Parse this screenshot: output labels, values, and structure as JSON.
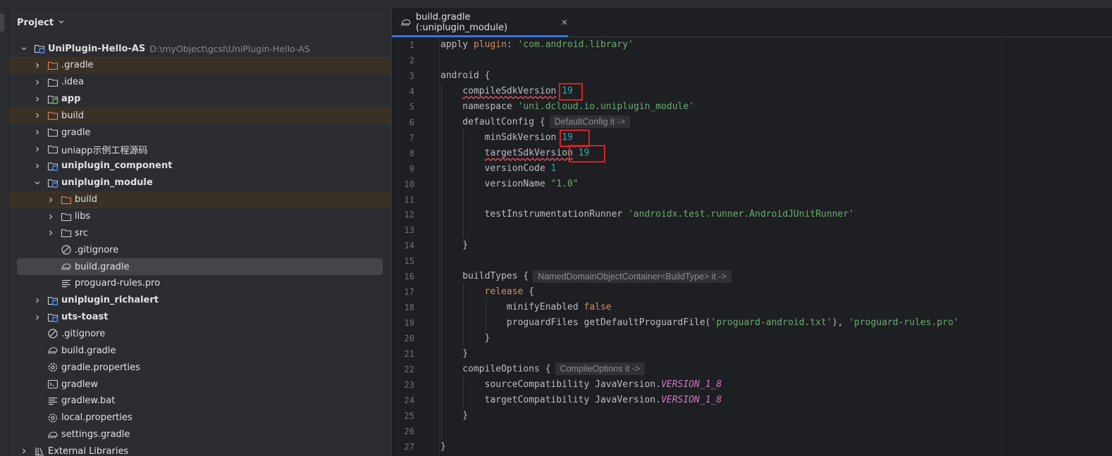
{
  "panel": {
    "title": "Project"
  },
  "tree": [
    {
      "label": "UniPlugin-Hello-AS",
      "path": "D:\\myObject\\gcsl\\UniPlugin-Hello-AS",
      "icon": "module-folder-icon",
      "arrow": "down",
      "depth": 0,
      "bold": true
    },
    {
      "label": ".gradle",
      "icon": "excluded-folder-icon",
      "arrow": "right",
      "depth": 1,
      "excluded": true
    },
    {
      "label": ".idea",
      "icon": "folder-icon",
      "arrow": "right",
      "depth": 1
    },
    {
      "label": "app",
      "icon": "app-module-icon",
      "arrow": "right",
      "depth": 1,
      "bold": true
    },
    {
      "label": "build",
      "icon": "excluded-folder-icon",
      "arrow": "right",
      "depth": 1,
      "excluded": true
    },
    {
      "label": "gradle",
      "icon": "folder-icon",
      "arrow": "right",
      "depth": 1
    },
    {
      "label": "uniapp示例工程源码",
      "icon": "folder-icon",
      "arrow": "right",
      "depth": 1
    },
    {
      "label": "uniplugin_component",
      "icon": "module-folder-icon",
      "arrow": "right",
      "depth": 1,
      "bold": true
    },
    {
      "label": "uniplugin_module",
      "icon": "module-folder-icon",
      "arrow": "down",
      "depth": 1,
      "bold": true
    },
    {
      "label": "build",
      "icon": "excluded-folder-icon",
      "arrow": "right",
      "depth": 2,
      "excluded": true
    },
    {
      "label": "libs",
      "icon": "folder-icon",
      "arrow": "right",
      "depth": 2
    },
    {
      "label": "src",
      "icon": "folder-icon",
      "arrow": "right",
      "depth": 2
    },
    {
      "label": ".gitignore",
      "icon": "ignore-file-icon",
      "arrow": "none",
      "depth": 2
    },
    {
      "label": "build.gradle",
      "icon": "gradle-icon",
      "arrow": "none",
      "depth": 2,
      "selected": true
    },
    {
      "label": "proguard-rules.pro",
      "icon": "text-file-icon",
      "arrow": "none",
      "depth": 2
    },
    {
      "label": "uniplugin_richalert",
      "icon": "module-folder-icon",
      "arrow": "right",
      "depth": 1,
      "bold": true
    },
    {
      "label": "uts-toast",
      "icon": "module-folder-icon",
      "arrow": "right",
      "depth": 1,
      "bold": true
    },
    {
      "label": ".gitignore",
      "icon": "ignore-file-icon",
      "arrow": "none",
      "depth": 1
    },
    {
      "label": "build.gradle",
      "icon": "gradle-icon",
      "arrow": "none",
      "depth": 1
    },
    {
      "label": "gradle.properties",
      "icon": "settings-file-icon",
      "arrow": "none",
      "depth": 1
    },
    {
      "label": "gradlew",
      "icon": "terminal-file-icon",
      "arrow": "none",
      "depth": 1
    },
    {
      "label": "gradlew.bat",
      "icon": "text-file-icon",
      "arrow": "none",
      "depth": 1
    },
    {
      "label": "local.properties",
      "icon": "settings-file-icon",
      "arrow": "none",
      "depth": 1
    },
    {
      "label": "settings.gradle",
      "icon": "gradle-icon",
      "arrow": "none",
      "depth": 1
    },
    {
      "label": "External Libraries",
      "icon": "library-icon",
      "arrow": "right",
      "depth": 0
    }
  ],
  "editor": {
    "tab_label": "build.gradle (:uniplugin_module)",
    "line_numbers": [
      "1",
      "2",
      "3",
      "4",
      "5",
      "6",
      "7",
      "8",
      "9",
      "10",
      "11",
      "12",
      "13",
      "14",
      "15",
      "16",
      "17",
      "18",
      "19",
      "20",
      "21",
      "22",
      "23",
      "24",
      "25",
      "26",
      "27"
    ],
    "lines": [
      [
        {
          "t": "apply "
        },
        {
          "t": "plugin",
          "c": "k"
        },
        {
          "t": ": "
        },
        {
          "t": "'com.android.library'",
          "c": "s"
        }
      ],
      [],
      [
        {
          "t": "android {"
        }
      ],
      [
        {
          "t": "    "
        },
        {
          "t": "compileSdkVersion",
          "c": "strike warn"
        },
        {
          "t": " "
        },
        {
          "t": "19",
          "c": "n"
        }
      ],
      [
        {
          "t": "    namespace "
        },
        {
          "t": "'uni.dcloud.io.uniplugin_module'",
          "c": "s"
        }
      ],
      [
        {
          "t": "    defaultConfig {"
        },
        {
          "hint": "DefaultConfig it ->"
        }
      ],
      [
        {
          "t": "        minSdkVersion "
        },
        {
          "t": "19",
          "c": "n"
        }
      ],
      [
        {
          "t": "        "
        },
        {
          "t": "targetSdkVersion",
          "c": "warn"
        },
        {
          "t": " "
        },
        {
          "t": "19",
          "c": "n"
        }
      ],
      [
        {
          "t": "        versionCode "
        },
        {
          "t": "1",
          "c": "n"
        }
      ],
      [
        {
          "t": "        versionName "
        },
        {
          "t": "\"1.0\"",
          "c": "s"
        }
      ],
      [],
      [
        {
          "t": "        testInstrumentationRunner "
        },
        {
          "t": "'androidx.test.runner.AndroidJUnitRunner'",
          "c": "s"
        }
      ],
      [],
      [
        {
          "t": "    }"
        }
      ],
      [],
      [
        {
          "t": "    buildTypes {"
        },
        {
          "hint": "NamedDomainObjectContainer<BuildType> it ->"
        }
      ],
      [
        {
          "t": "        "
        },
        {
          "t": "release",
          "c": "k"
        },
        {
          "t": " {"
        }
      ],
      [
        {
          "t": "            minifyEnabled "
        },
        {
          "t": "false",
          "c": "k"
        }
      ],
      [
        {
          "t": "            proguardFiles getDefaultProguardFile("
        },
        {
          "t": "'proguard-android.txt'",
          "c": "s"
        },
        {
          "t": "), "
        },
        {
          "t": "'proguard-rules.pro'",
          "c": "s"
        }
      ],
      [
        {
          "t": "        }"
        }
      ],
      [
        {
          "t": "    }"
        }
      ],
      [
        {
          "t": "    compileOptions {"
        },
        {
          "hint": "CompileOptions it ->"
        }
      ],
      [
        {
          "t": "        sourceCompatibility JavaVersion."
        },
        {
          "t": "VERSION_1_8",
          "c": "it"
        }
      ],
      [
        {
          "t": "        targetCompatibility JavaVersion."
        },
        {
          "t": "VERSION_1_8",
          "c": "it"
        }
      ],
      [
        {
          "t": "    }"
        }
      ],
      [],
      [
        {
          "t": "}"
        }
      ]
    ]
  },
  "colors": {
    "accent": "#3574f0",
    "annotation": "#e01e1e",
    "excluded_bg": "#3a3126"
  }
}
